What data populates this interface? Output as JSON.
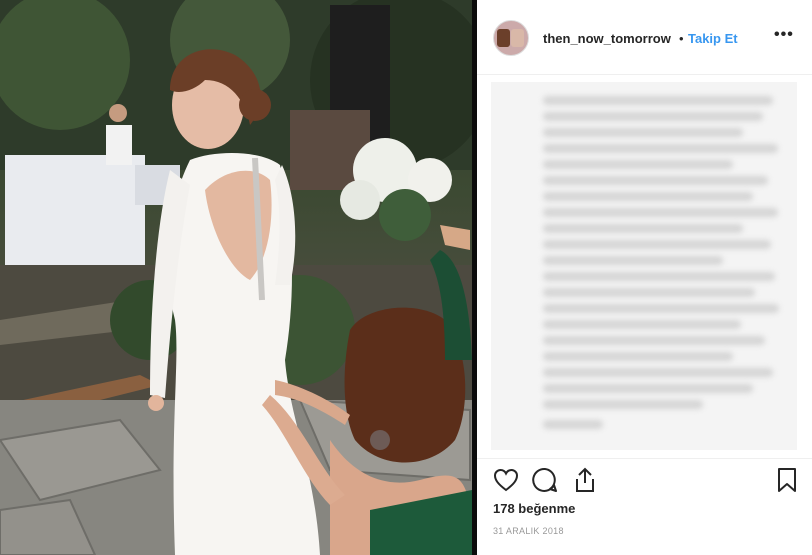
{
  "post": {
    "photo_alt": "wedding-photo",
    "header": {
      "username": "then_now_tomorrow",
      "separator": "•",
      "follow_label": "Takip Et",
      "more_label": "•••"
    },
    "likes": "178 beğenme",
    "date": "31 ARALIK 2018"
  },
  "colors": {
    "link": "#3897f0",
    "text": "#262626",
    "muted": "#999999"
  },
  "icons": [
    "heart-icon",
    "comment-icon",
    "share-icon",
    "bookmark-icon"
  ]
}
